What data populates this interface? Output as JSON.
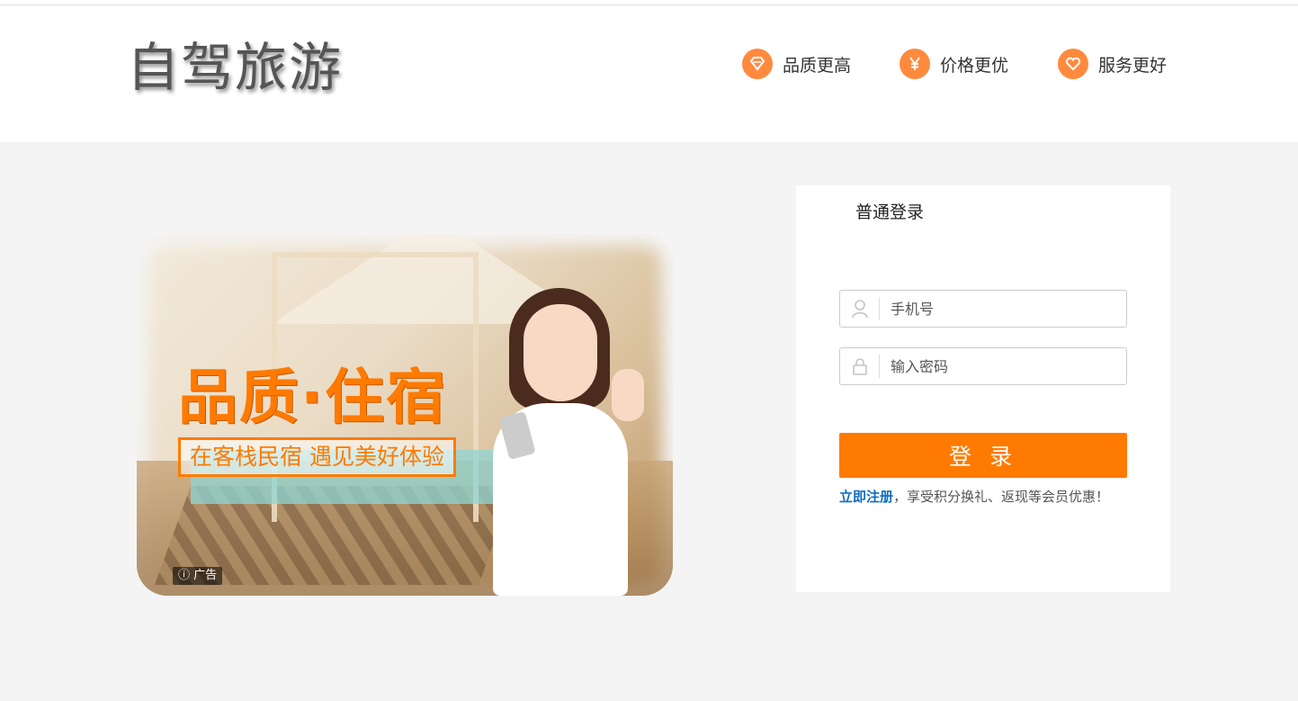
{
  "header": {
    "logo_text": "自驾旅游",
    "features": [
      {
        "icon": "diamond-icon",
        "label": "品质更高"
      },
      {
        "icon": "yen-icon",
        "label": "价格更优"
      },
      {
        "icon": "heart-icon",
        "label": "服务更好"
      }
    ],
    "accent_color": "#ff8a3d"
  },
  "banner": {
    "title": "品质·住宿",
    "subtitle": "在客栈民宿 遇见美好体验",
    "ad_label": "广告"
  },
  "login": {
    "tab_label": "普通登录",
    "phone_placeholder": "手机号",
    "password_placeholder": "输入密码",
    "submit_label": "登 录",
    "register_link": "立即注册",
    "register_text": "，享受积分换礼、返现等会员优惠！",
    "button_color": "#ff7a00"
  }
}
